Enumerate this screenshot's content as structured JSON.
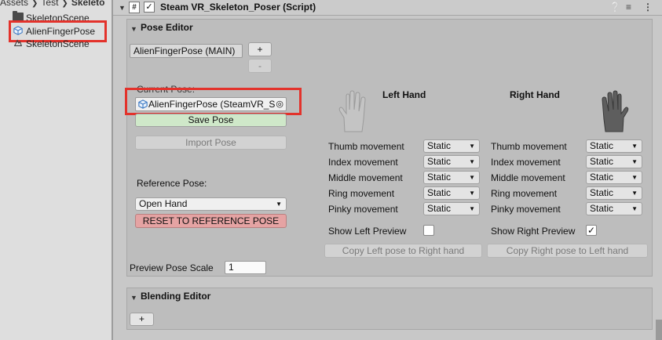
{
  "project": {
    "breadcrumb": [
      "Assets",
      "Test",
      "Skeleto"
    ],
    "items": [
      {
        "label": "SkeletonScene",
        "icon": "folder-icon"
      },
      {
        "label": "AlienFingerPose",
        "icon": "prefab-icon"
      },
      {
        "label": "SkeletonScene",
        "icon": "scene-icon"
      }
    ]
  },
  "component": {
    "title": "Steam VR_Skeleton_Poser (Script)",
    "enabled": true,
    "icons": [
      "help-icon",
      "preset-icon",
      "menu-icon"
    ]
  },
  "pose_editor": {
    "title": "Pose Editor",
    "pose_name": "AlienFingerPose (MAIN)",
    "add_label": "+",
    "remove_label": "-",
    "current_pose_label": "Current Pose:",
    "current_pose_value": "AlienFingerPose (SteamVR_S",
    "save_pose": "Save Pose",
    "import_pose": "Import Pose",
    "reference_pose_label": "Reference Pose:",
    "reference_pose_value": "Open Hand",
    "reset_button": "RESET TO REFERENCE POSE",
    "preview_scale_label": "Preview Pose Scale",
    "preview_scale_value": "1",
    "left": {
      "header": "Left Hand",
      "movements": [
        {
          "label": "Thumb movement",
          "value": "Static"
        },
        {
          "label": "Index movement",
          "value": "Static"
        },
        {
          "label": "Middle movement",
          "value": "Static"
        },
        {
          "label": "Ring movement",
          "value": "Static"
        },
        {
          "label": "Pinky movement",
          "value": "Static"
        }
      ],
      "preview_label": "Show Left Preview",
      "preview_checked": false,
      "copy_button": "Copy Left pose to Right hand"
    },
    "right": {
      "header": "Right Hand",
      "movements": [
        {
          "label": "Thumb movement",
          "value": "Static"
        },
        {
          "label": "Index movement",
          "value": "Static"
        },
        {
          "label": "Middle movement",
          "value": "Static"
        },
        {
          "label": "Ring movement",
          "value": "Static"
        },
        {
          "label": "Pinky movement",
          "value": "Static"
        }
      ],
      "preview_label": "Show Right Preview",
      "preview_checked": true,
      "check_mark": "✓",
      "copy_button": "Copy Right pose to Left hand"
    }
  },
  "blending_editor": {
    "title": "Blending Editor",
    "add_label": "+"
  },
  "colors": {
    "highlight": "#e3322b",
    "save_green": "#cfe8c9",
    "reset_red": "#e5a3a3"
  }
}
